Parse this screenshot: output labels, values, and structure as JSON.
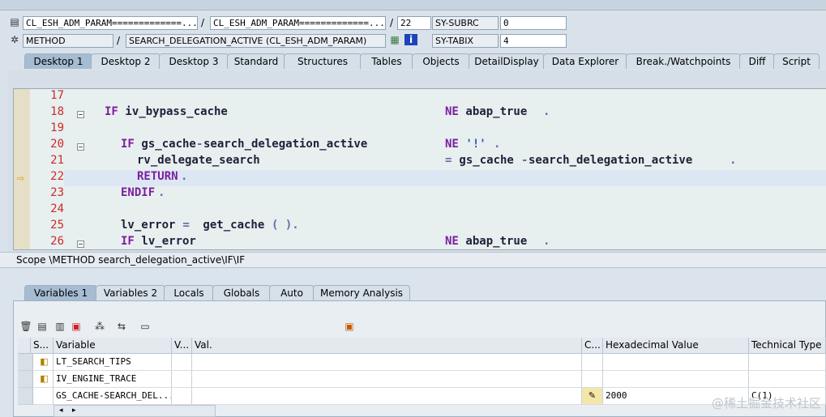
{
  "header": {
    "row1": {
      "program": "CL_ESH_ADM_PARAM=============...",
      "include": "CL_ESH_ADM_PARAM=============...",
      "line": "22",
      "sysfield_name": "SY-SUBRC",
      "sysfield_value": "0"
    },
    "row2": {
      "type": "METHOD",
      "event": "SEARCH_DELEGATION_ACTIVE (CL_ESH_ADM_PARAM)",
      "sysfield_name": "SY-TABIX",
      "sysfield_value": "4"
    },
    "sep": "/"
  },
  "desktop_tabs": [
    "Desktop 1",
    "Desktop 2",
    "Desktop 3",
    "Standard",
    "Structures",
    "Tables",
    "Objects",
    "DetailDisplay",
    "Data Explorer",
    "Break./Watchpoints",
    "Diff",
    "Script"
  ],
  "code": {
    "lines": [
      "17",
      "18",
      "19",
      "20",
      "21",
      "22",
      "23",
      "24",
      "25",
      "26"
    ],
    "l18": {
      "a": "IF",
      "b": " iv_bypass_cache",
      "c": "NE",
      "d": " abap_true",
      "e": "."
    },
    "l20": {
      "a": "IF",
      "b": " gs_cache",
      "c": "-",
      "d": "search_delegation_active",
      "e": "NE",
      "f": " '!'",
      "g": "."
    },
    "l21": {
      "a": "rv_delegate_search",
      "b": "=",
      "c": " gs_cache",
      "d": "-",
      "e": "search_delegation_active",
      "f": "."
    },
    "l22": {
      "a": "RETURN",
      "b": "."
    },
    "l23": {
      "a": "ENDIF",
      "b": "."
    },
    "l25": {
      "a": "lv_error",
      "b": " =",
      "c": " get_cache",
      "d": "( ).",
      "e": ""
    },
    "l26": {
      "a": "IF",
      "b": " lv_error",
      "c": "NE",
      "d": " abap_true",
      "e": "."
    }
  },
  "scope": "Scope \\METHOD search_delegation_active\\IF\\IF",
  "variable_tabs": [
    "Variables 1",
    "Variables 2",
    "Locals",
    "Globals",
    "Auto",
    "Memory Analysis"
  ],
  "table": {
    "headers": [
      "S...",
      "Variable",
      "V...",
      "Val.",
      "C...",
      "Hexadecimal Value",
      "Technical Type"
    ],
    "rows": [
      {
        "variable": "LT_SEARCH_TIPS",
        "value": "",
        "hex": "",
        "type": ""
      },
      {
        "variable": "IV_ENGINE_TRACE",
        "value": "",
        "hex": "",
        "type": ""
      },
      {
        "variable": "GS_CACHE-SEARCH_DEL...",
        "value": "",
        "hex": "2000",
        "type": "C(1)"
      }
    ]
  },
  "watermark": "@稀土掘金技术社区"
}
